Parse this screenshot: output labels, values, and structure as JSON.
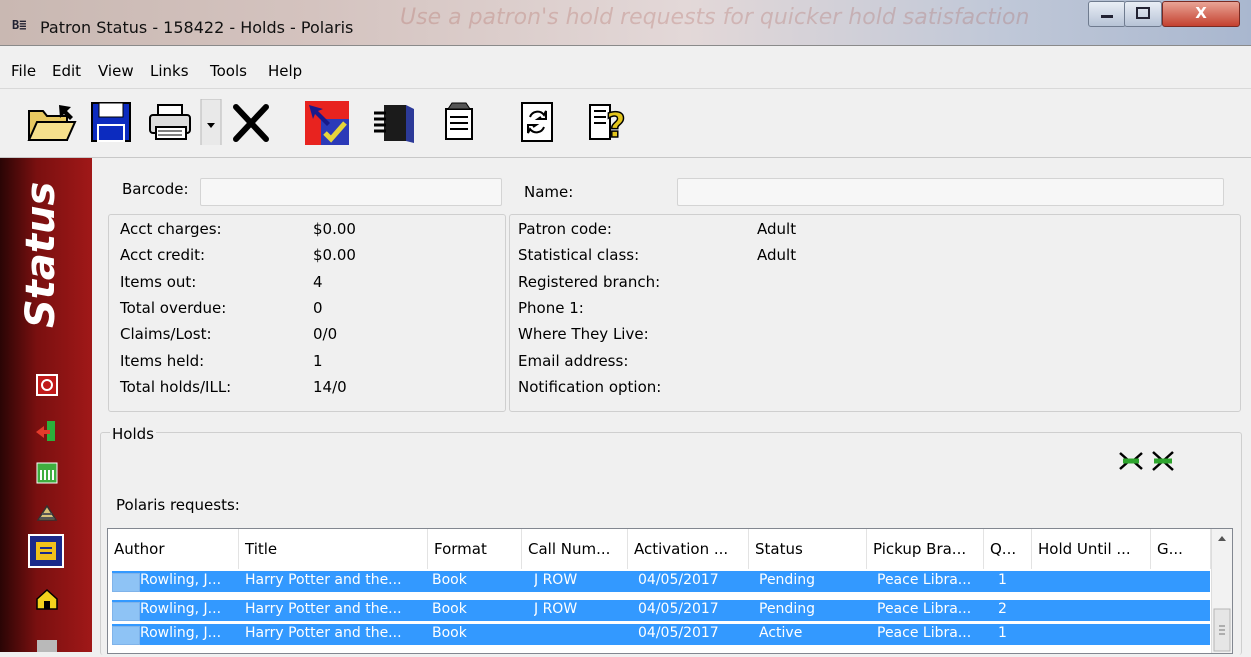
{
  "window": {
    "app_icon": "B≣",
    "title": "Patron Status - 158422 - Holds - Polaris",
    "background_caption": "Use a patron's hold requests for quicker hold satisfaction",
    "close_glyph": "X"
  },
  "menu": [
    "File",
    "Edit",
    "View",
    "Links",
    "Tools",
    "Help"
  ],
  "toolbar": {
    "icons": [
      "open-folder-icon",
      "save-icon",
      "print-icon",
      "dropdown-arrow-icon",
      "delete-x-icon",
      "checkin-icon",
      "records-icon",
      "properties-icon",
      "refresh-icon",
      "help-icon"
    ]
  },
  "sidebar": {
    "title": "Status",
    "icons": [
      "status-charges-icon",
      "checkout-icon",
      "items-out-icon",
      "claims-icon",
      "holds-icon",
      "home-icon",
      "more-icon"
    ],
    "accent": "#a01818"
  },
  "patron": {
    "barcode_label": "Barcode:",
    "name_label": "Name:",
    "left": [
      {
        "label": "Acct charges:",
        "value": "$0.00"
      },
      {
        "label": "Acct credit:",
        "value": "$0.00"
      },
      {
        "label": "Items out:",
        "value": "4"
      },
      {
        "label": "Total overdue:",
        "value": "0"
      },
      {
        "label": "Claims/Lost:",
        "value": "0/0"
      },
      {
        "label": "Items held:",
        "value": "1"
      },
      {
        "label": "Total holds/ILL:",
        "value": "14/0"
      }
    ],
    "right": [
      {
        "label": "Patron code:",
        "value": "Adult"
      },
      {
        "label": "Statistical class:",
        "value": "Adult"
      },
      {
        "label": "Registered branch:",
        "value": ""
      },
      {
        "label": "Phone 1:",
        "value": ""
      },
      {
        "label": "Where They Live:",
        "value": ""
      },
      {
        "label": "Email address:",
        "value": ""
      },
      {
        "label": "Notification option:",
        "value": ""
      }
    ]
  },
  "holds": {
    "group_label": "Holds",
    "requests_label": "Polaris requests:",
    "columns": [
      "Author",
      "Title",
      "Format",
      "Call Num...",
      "Activation ...",
      "Status",
      "Pickup Bra...",
      "Q...",
      "Hold Until ...",
      "G..."
    ],
    "rows": [
      {
        "author": "Rowling, J...",
        "title": "Harry Potter and the...",
        "format": "Book",
        "call_number": "J ROW",
        "activation": "04/05/2017",
        "status": "Pending",
        "pickup": "Peace Libra...",
        "queue": "1"
      },
      {
        "author": "Rowling, J...",
        "title": "Harry Potter and the...",
        "format": "Book",
        "call_number": "J ROW",
        "activation": "04/05/2017",
        "status": "Pending",
        "pickup": "Peace Libra...",
        "queue": "2"
      },
      {
        "author": "Rowling, J...",
        "title": "Harry Potter and the...",
        "format": "Book",
        "call_number": "",
        "activation": "04/05/2017",
        "status": "Active",
        "pickup": "Peace Libra...",
        "queue": "1"
      }
    ],
    "selection_color": "#3399ff"
  }
}
